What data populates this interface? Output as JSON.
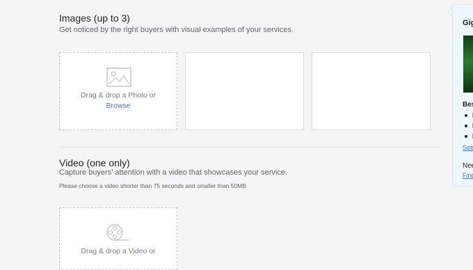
{
  "images_section": {
    "title": "Images (up to 3)",
    "description": "Get noticed by the right buyers with visual examples of your services.",
    "dropzone": {
      "text": "Drag & drop a Photo or",
      "browse_label": "Browse",
      "icon": "image-icon"
    }
  },
  "video_section": {
    "title": "Video (one only)",
    "description": "Capture buyers' attention with a video that showcases your service.",
    "note": "Please choose a video shorter than 75 seconds and smaller than 50MB",
    "dropzone": {
      "text": "Drag & drop a Video or",
      "icon": "film-reel-icon"
    }
  },
  "tips_panel": {
    "title": "Gig",
    "best_label": "Bes",
    "see_link": "See",
    "need_label": "Nee",
    "find_link": "Find"
  },
  "colors": {
    "link": "#446ee7",
    "tips_bullet_accent": "#e28a2b"
  }
}
